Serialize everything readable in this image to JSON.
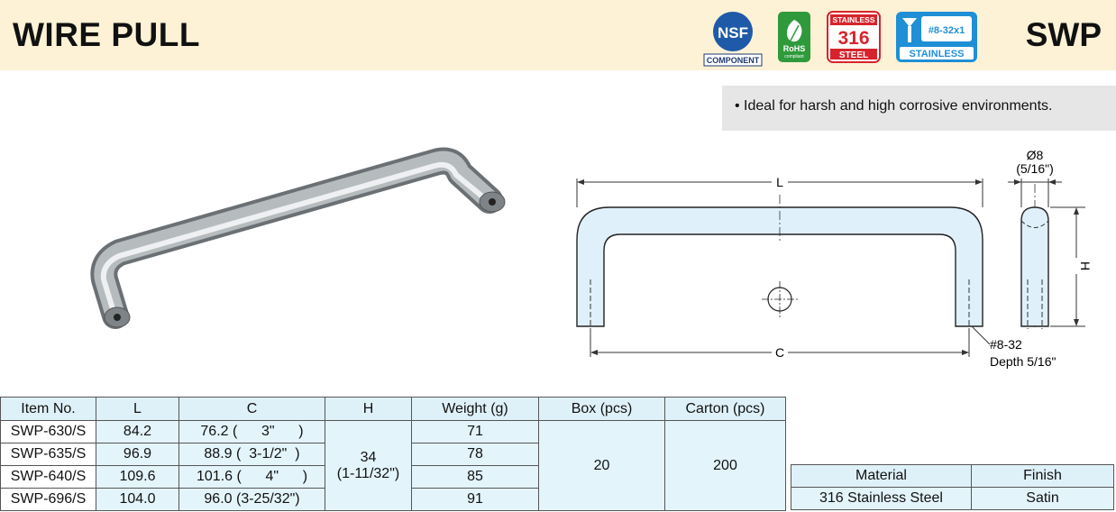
{
  "header": {
    "title": "WIRE PULL",
    "code": "SWP",
    "badges": {
      "nsf_top": "NSF",
      "nsf_bottom": "COMPONENT",
      "rohs_line1": "RoHS",
      "rohs_line2": "compliant",
      "steel_line1": "STAINLESS",
      "steel_line2": "316",
      "steel_line3": "STEEL",
      "screw_spec": "#8-32x1",
      "screw_label": "STAINLESS"
    }
  },
  "feature": "• Ideal for harsh and high corrosive environments.",
  "drawing": {
    "dim_L": "L",
    "dim_C": "C",
    "dim_H": "H",
    "diameter": "Ø8",
    "diameter_in": "(5/16\")",
    "thread": "#8-32",
    "depth": "Depth 5/16\""
  },
  "spec_table": {
    "headers": [
      "Item No.",
      "L",
      "C",
      "H",
      "Weight (g)",
      "Box (pcs)",
      "Carton (pcs)"
    ],
    "rows": [
      {
        "item": "SWP-630/S",
        "L": "84.2",
        "C": "76.2 (      3\"      )",
        "weight": "71"
      },
      {
        "item": "SWP-635/S",
        "L": "96.9",
        "C": "88.9 (  3-1/2\"  )",
        "weight": "78"
      },
      {
        "item": "SWP-640/S",
        "L": "109.6",
        "C": "101.6 (      4\"      )",
        "weight": "85"
      },
      {
        "item": "SWP-696/S",
        "L": "104.0",
        "C": "96.0 (3-25/32\")",
        "weight": "91"
      }
    ],
    "H_value": "34",
    "H_inch": "(1-11/32\")",
    "box": "20",
    "carton": "200"
  },
  "material_table": {
    "headers": [
      "Material",
      "Finish"
    ],
    "material": "316 Stainless Steel",
    "finish": "Satin"
  }
}
